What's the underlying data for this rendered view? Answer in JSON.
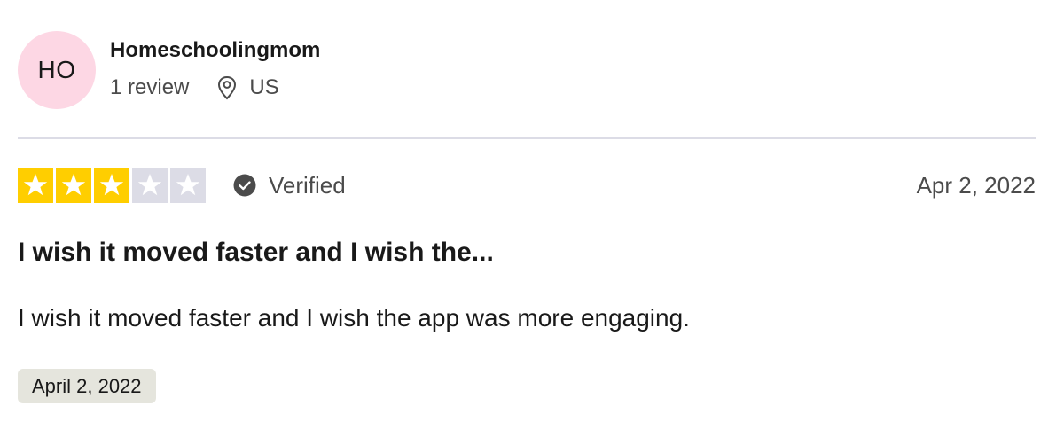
{
  "reviewer": {
    "initials": "HO",
    "avatar_color": "#fdd7e4",
    "name": "Homeschoolingmom",
    "review_count": "1 review",
    "location_icon": "location-pin-icon",
    "country": "US"
  },
  "review": {
    "rating": 3,
    "max_rating": 5,
    "star_on_color": "#ffce00",
    "star_off_color": "#dcdce6",
    "verified_icon": "check-circle-icon",
    "verified_label": "Verified",
    "date": "Apr 2, 2022",
    "title": "I wish it moved faster and I wish the...",
    "body": "I wish it moved faster and I wish the app was more engaging.",
    "experience_date": "April 2, 2022"
  }
}
